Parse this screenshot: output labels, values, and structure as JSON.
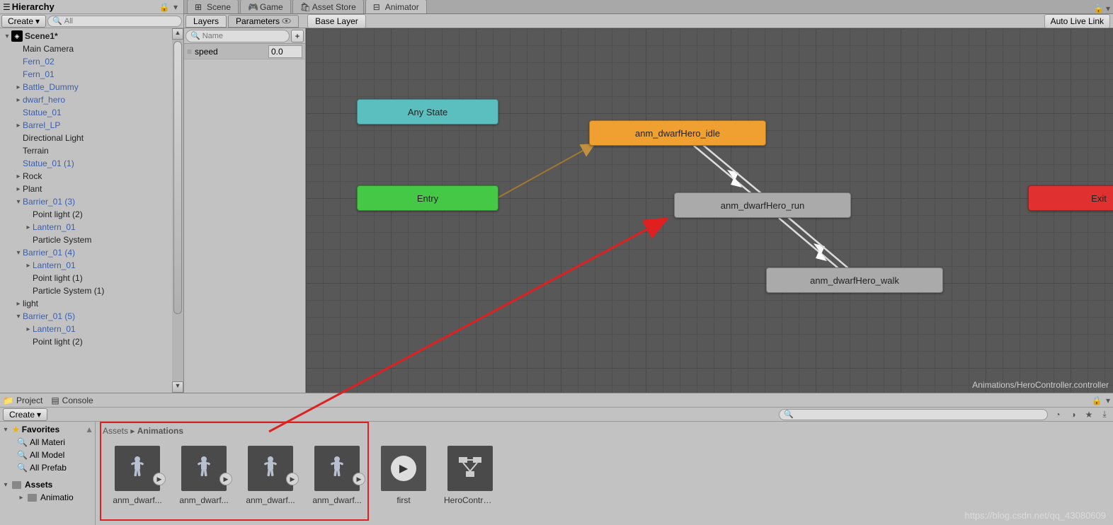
{
  "hierarchy": {
    "title": "Hierarchy",
    "create": "Create",
    "search_placeholder": "All",
    "scene": "Scene1*",
    "items": [
      {
        "label": "Main Camera",
        "blue": false,
        "indent": 1,
        "fold": ""
      },
      {
        "label": "Fern_02",
        "blue": true,
        "indent": 1,
        "fold": ""
      },
      {
        "label": "Fern_01",
        "blue": true,
        "indent": 1,
        "fold": ""
      },
      {
        "label": "Battle_Dummy",
        "blue": true,
        "indent": 1,
        "fold": "▸"
      },
      {
        "label": "dwarf_hero",
        "blue": true,
        "indent": 1,
        "fold": "▸"
      },
      {
        "label": "Statue_01",
        "blue": true,
        "indent": 1,
        "fold": ""
      },
      {
        "label": "Barrel_LP",
        "blue": true,
        "indent": 1,
        "fold": "▸"
      },
      {
        "label": "Directional Light",
        "blue": false,
        "indent": 1,
        "fold": ""
      },
      {
        "label": "Terrain",
        "blue": false,
        "indent": 1,
        "fold": ""
      },
      {
        "label": "Statue_01 (1)",
        "blue": true,
        "indent": 1,
        "fold": ""
      },
      {
        "label": "Rock",
        "blue": false,
        "indent": 1,
        "fold": "▸"
      },
      {
        "label": "Plant",
        "blue": false,
        "indent": 1,
        "fold": "▸"
      },
      {
        "label": "Barrier_01 (3)",
        "blue": true,
        "indent": 1,
        "fold": "▾"
      },
      {
        "label": "Point light (2)",
        "blue": false,
        "indent": 2,
        "fold": ""
      },
      {
        "label": "Lantern_01",
        "blue": true,
        "indent": 2,
        "fold": "▸"
      },
      {
        "label": "Particle System",
        "blue": false,
        "indent": 2,
        "fold": ""
      },
      {
        "label": "Barrier_01 (4)",
        "blue": true,
        "indent": 1,
        "fold": "▾"
      },
      {
        "label": "Lantern_01",
        "blue": true,
        "indent": 2,
        "fold": "▸"
      },
      {
        "label": "Point light (1)",
        "blue": false,
        "indent": 2,
        "fold": ""
      },
      {
        "label": "Particle System (1)",
        "blue": false,
        "indent": 2,
        "fold": ""
      },
      {
        "label": "light",
        "blue": false,
        "indent": 1,
        "fold": "▸"
      },
      {
        "label": "Barrier_01 (5)",
        "blue": true,
        "indent": 1,
        "fold": "▾"
      },
      {
        "label": "Lantern_01",
        "blue": true,
        "indent": 2,
        "fold": "▸"
      },
      {
        "label": "Point light (2)",
        "blue": false,
        "indent": 2,
        "fold": ""
      }
    ]
  },
  "tabs": {
    "scene": "Scene",
    "game": "Game",
    "asset_store": "Asset Store",
    "animator": "Animator"
  },
  "animator": {
    "layers": "Layers",
    "parameters": "Parameters",
    "breadcrumb": "Base Layer",
    "auto_live": "Auto Live Link",
    "param_search": "Name",
    "speed": {
      "name": "speed",
      "value": "0.0"
    },
    "nodes": {
      "any": "Any State",
      "entry": "Entry",
      "idle": "anm_dwarfHero_idle",
      "run": "anm_dwarfHero_run",
      "walk": "anm_dwarfHero_walk",
      "exit": "Exit"
    },
    "path": "Animations/HeroController.controller"
  },
  "project": {
    "tab_project": "Project",
    "tab_console": "Console",
    "create": "Create",
    "favorites": "Favorites",
    "fav_items": [
      "All Materi",
      "All Model",
      "All Prefab"
    ],
    "assets": "Assets",
    "assets_items": [
      "Animatio"
    ],
    "crumb_assets": "Assets",
    "crumb_anim": "Animations",
    "items": [
      {
        "label": "anm_dwarf...",
        "type": "anim"
      },
      {
        "label": "anm_dwarf...",
        "type": "anim"
      },
      {
        "label": "anm_dwarf...",
        "type": "anim"
      },
      {
        "label": "anm_dwarf...",
        "type": "anim"
      },
      {
        "label": "first",
        "type": "clip"
      },
      {
        "label": "HeroControl...",
        "type": "controller"
      }
    ]
  },
  "watermark": "https://blog.csdn.net/qq_43080609"
}
